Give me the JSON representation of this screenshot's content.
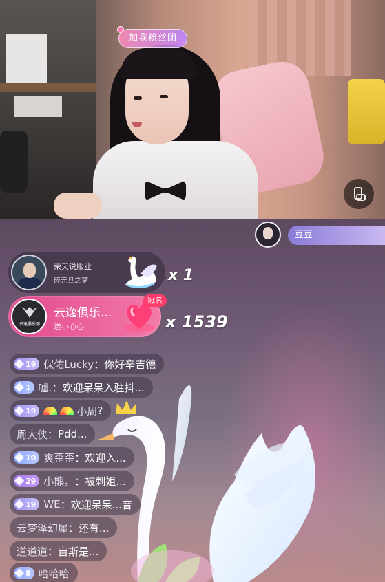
{
  "stream": {
    "fan_club_tag": "加我粉丝团",
    "rotate_icon": "screen-rotate-icon"
  },
  "viewer": {
    "name": "豆豆"
  },
  "gifts": [
    {
      "user": "荣天说服业",
      "subtitle": "碎元旦之梦",
      "gift_icon": "swan-icon",
      "count": "x 1"
    },
    {
      "user": "云逸俱乐...",
      "subtitle": "送小心心",
      "gift_icon": "heart-icon",
      "count": "x 1539",
      "badge": "冠名",
      "avatar_logo": "云逸俱乐部"
    }
  ],
  "messages": [
    {
      "level": "19",
      "name": "保佑Lucky",
      "text": "你好辛吉德"
    },
    {
      "level": "1",
      "name": "嘘.",
      "text": "欢迎呆呆入驻抖..."
    },
    {
      "level": "19",
      "name": "小周",
      "text": "?",
      "rainbow": true
    },
    {
      "level": "",
      "name": "周大侠",
      "text": "Pdd..."
    },
    {
      "level": "10",
      "name": "爽歪歪",
      "text": "欢迎入..."
    },
    {
      "level": "29",
      "name": "小熊。",
      "text": "被刺姐..."
    },
    {
      "level": "19",
      "name": "WE",
      "text": "欢迎呆呆...音"
    },
    {
      "level": "",
      "name": "云梦泽幻犀",
      "text": "还有..."
    },
    {
      "level": "",
      "name": "道道道",
      "text": "宙斯是..."
    },
    {
      "level": "8",
      "name": "哈哈哈",
      "text": ""
    }
  ],
  "colors": {
    "gift_highlight": "#e24a8f",
    "badge_red": "#ff3d6a",
    "level_purple": "#9a8ff0"
  }
}
